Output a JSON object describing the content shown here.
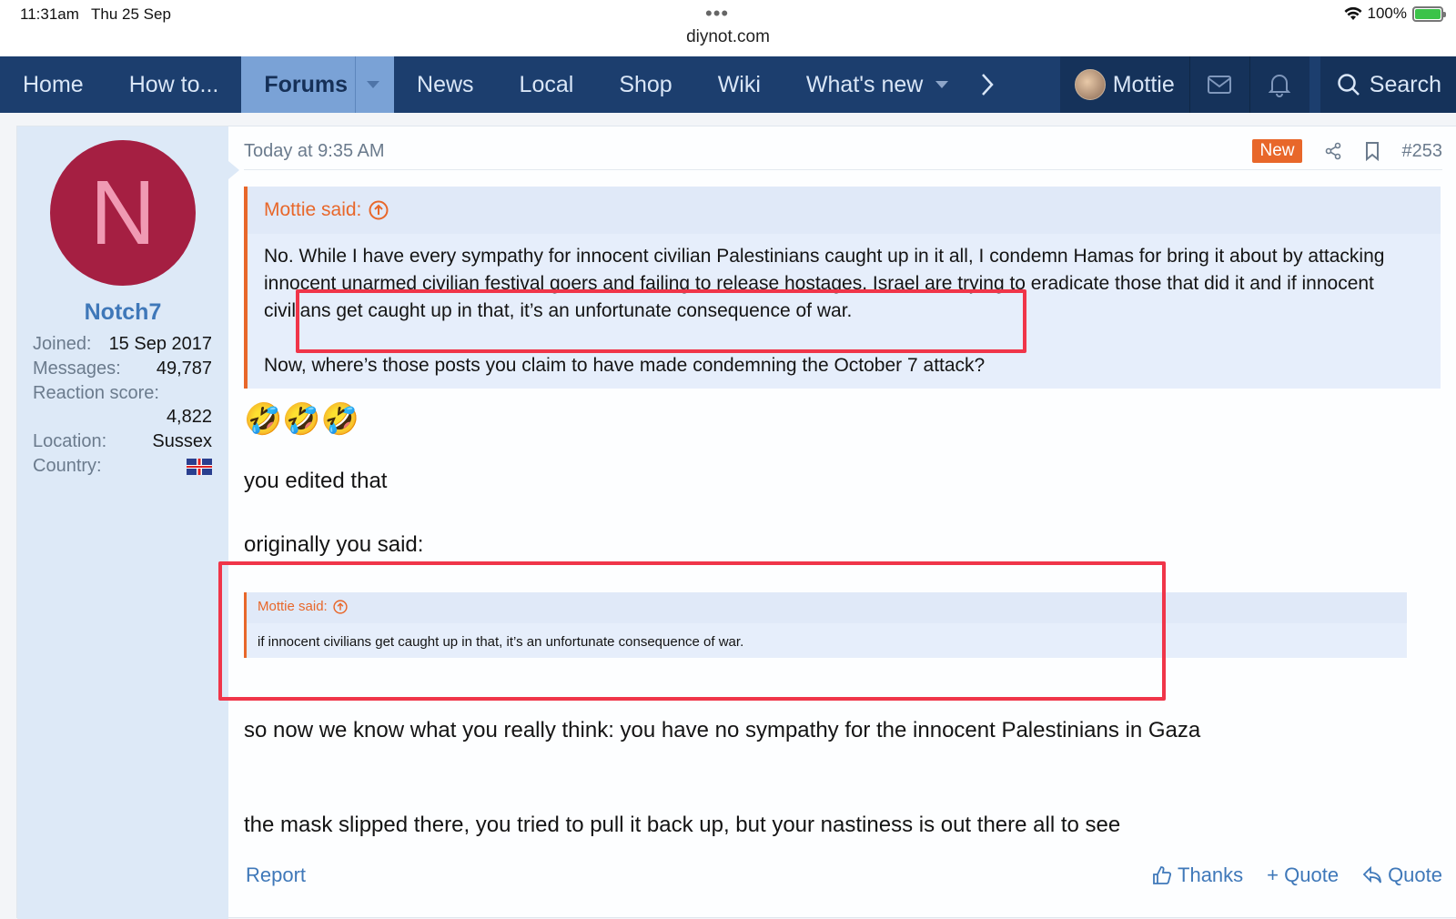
{
  "status": {
    "time": "11:31am",
    "date": "Thu 25 Sep",
    "url": "diynot.com",
    "battery": "100%"
  },
  "nav": {
    "items": [
      "Home",
      "How to...",
      "Forums",
      "News",
      "Local",
      "Shop",
      "Wiki",
      "What's new"
    ],
    "active": "Forums",
    "user": "Mottie",
    "search": "Search"
  },
  "author": {
    "initial": "N",
    "name": "Notch7",
    "joined_label": "Joined:",
    "joined": "15 Sep 2017",
    "messages_label": "Messages:",
    "messages": "49,787",
    "reaction_label": "Reaction score:",
    "reaction": "4,822",
    "location_label": "Location:",
    "location": "Sussex",
    "country_label": "Country:",
    "avatar_color": "#a51f42"
  },
  "post": {
    "timestamp": "Today at 9:35 AM",
    "badge": "New",
    "number": "#253",
    "quote": {
      "author": "Mottie said:",
      "p1": "No. While I have every sympathy for innocent civilian Palestinians caught up in it all, I condemn Hamas for bring it about by attacking innocent unarmed civilian festival goers and failing to release hostages. Israel are trying to eradicate those that did it and if innocent civilians get caught up in that, it’s an unfortunate consequence of war.",
      "p2": "Now, where’s those posts you claim to have made condemning the October 7 attack?"
    },
    "emojis": "🤣🤣🤣",
    "line1": "you edited that",
    "line2": "originally you said:",
    "quote2": {
      "author": "Mottie said:",
      "text": "if innocent civilians get caught up in that, it’s an unfortunate consequence of war."
    },
    "line3": "so now we know what you really think: you have no sympathy for the innocent Palestinians in Gaza",
    "line4": "the mask slipped there, you tried to pull it back up, but your nastiness is out there all to see"
  },
  "actions": {
    "report": "Report",
    "thanks": "Thanks",
    "plus_quote": "+ Quote",
    "quote": "Quote"
  },
  "colors": {
    "nav_bg": "#1c3e6e",
    "accent": "#e8672a",
    "link": "#3f78b9",
    "highlight": "#f03549"
  }
}
